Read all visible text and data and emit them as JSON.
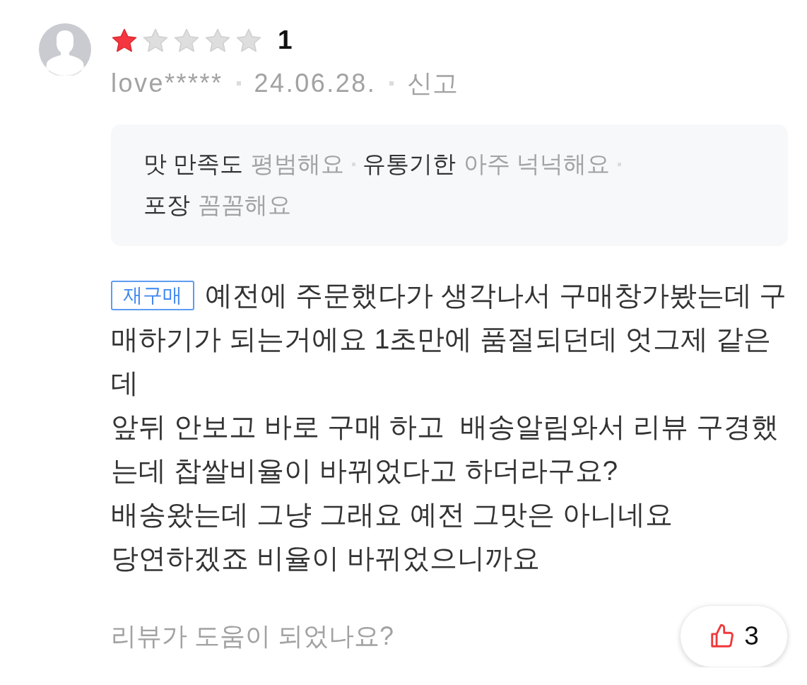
{
  "rating": {
    "stars": 1,
    "score": "1"
  },
  "reviewer": {
    "author": "love*****",
    "date": "24.06.28.",
    "report": "신고"
  },
  "attributes": [
    {
      "label": "맛 만족도",
      "value": "평범해요"
    },
    {
      "label": "유통기한",
      "value": "아주 넉넉해요"
    },
    {
      "label": "포장",
      "value": "꼼꼼해요"
    }
  ],
  "review": {
    "badge": "재구매",
    "text": "예전에 주문했다가 생각나서 구매창가봤는데 구매하기가 되는거에요 1초만에 품절되던데 엇그제 같은데\n앞뒤 안보고 바로 구매 하고  배송알림와서 리뷰 구경했는데 찹쌀비율이 바뀌었다고 하더라구요?\n배송왔는데 그냥 그래요 예전 그맛은 아니네요\n당연하겠죠 비율이 바뀌었으니까요"
  },
  "helpful": {
    "question": "리뷰가 도움이 되었나요?",
    "likes": "3"
  }
}
